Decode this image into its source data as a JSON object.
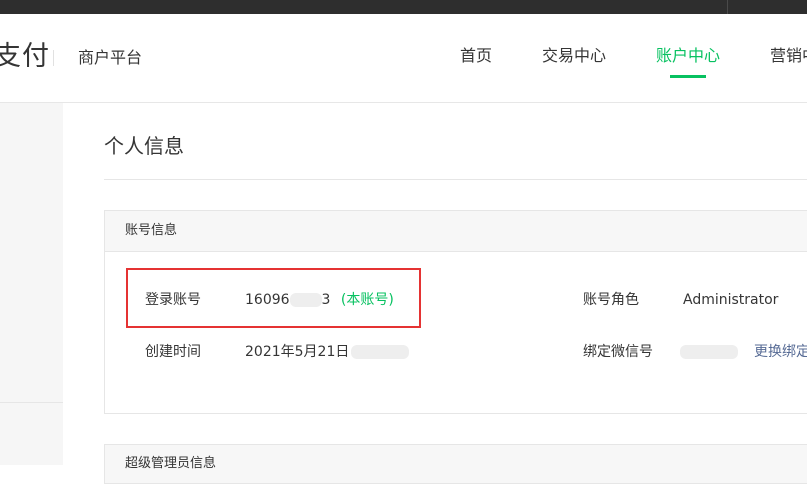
{
  "header": {
    "brand": "支付",
    "subtitle": "商户平台",
    "nav": [
      "首页",
      "交易中心",
      "账户中心",
      "营销中心"
    ],
    "active_nav": "账户中心"
  },
  "page": {
    "title": "个人信息"
  },
  "account_section": {
    "title": "账号信息",
    "login_label": "登录账号",
    "login_value_prefix": "16096",
    "login_value_suffix": "3",
    "login_tag": "(本账号)",
    "role_label": "账号角色",
    "role_value": "Administrator",
    "created_label": "创建时间",
    "created_value": "2021年5月21日",
    "wechat_label": "绑定微信号",
    "wechat_action": "更换绑定"
  },
  "admin_section": {
    "title": "超级管理员信息"
  },
  "colors": {
    "accent": "#07c160",
    "link": "#576b95",
    "highlight": "#e53333"
  }
}
